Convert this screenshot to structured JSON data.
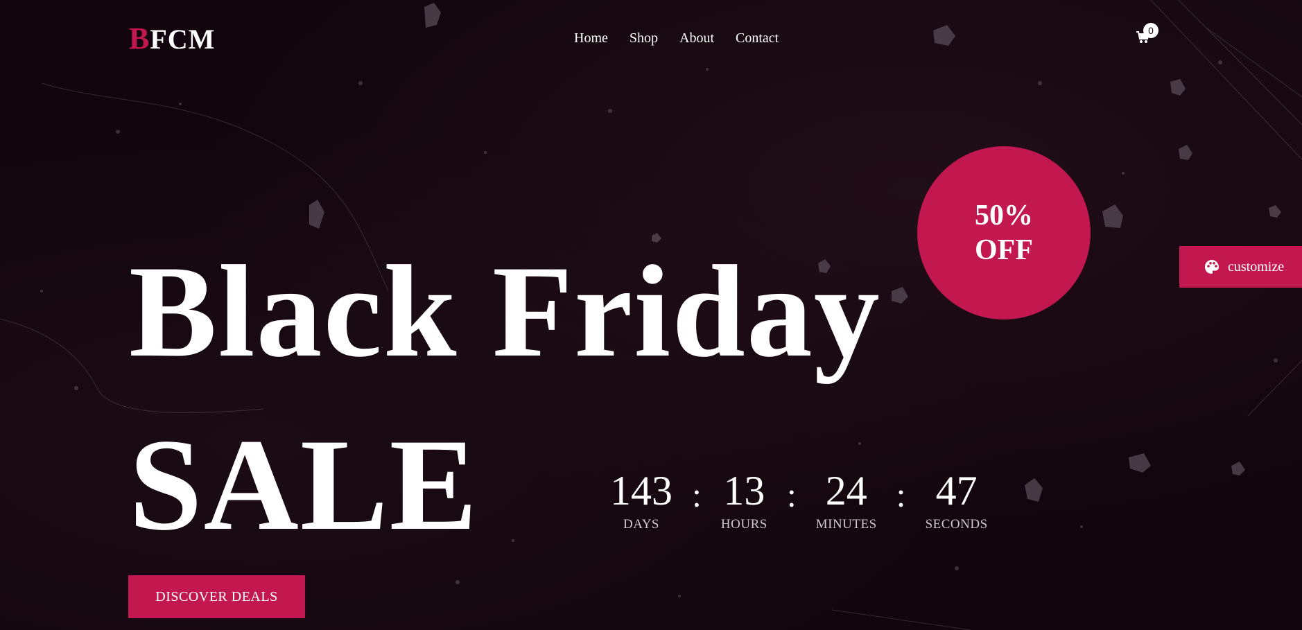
{
  "brand": {
    "logo_letter": "B",
    "logo_rest": "FCM"
  },
  "nav": {
    "items": [
      "Home",
      "Shop",
      "About",
      "Contact"
    ]
  },
  "cart": {
    "count": "0",
    "icon": "cart-icon"
  },
  "hero": {
    "line1": "Black Friday",
    "line2": "SALE"
  },
  "badge": {
    "line1": "50%",
    "line2": "OFF"
  },
  "customize": {
    "label": "customize",
    "icon": "palette-icon"
  },
  "countdown": {
    "days": {
      "value": "143",
      "label": "DAYS"
    },
    "hours": {
      "value": "13",
      "label": "HOURS"
    },
    "minutes": {
      "value": "24",
      "label": "MINUTES"
    },
    "seconds": {
      "value": "47",
      "label": "SECONDS"
    },
    "separator": ":"
  },
  "cta": {
    "label": "DISCOVER DEALS"
  },
  "colors": {
    "accent": "#c2174f",
    "background": "#12050d",
    "text": "#ffffff"
  }
}
